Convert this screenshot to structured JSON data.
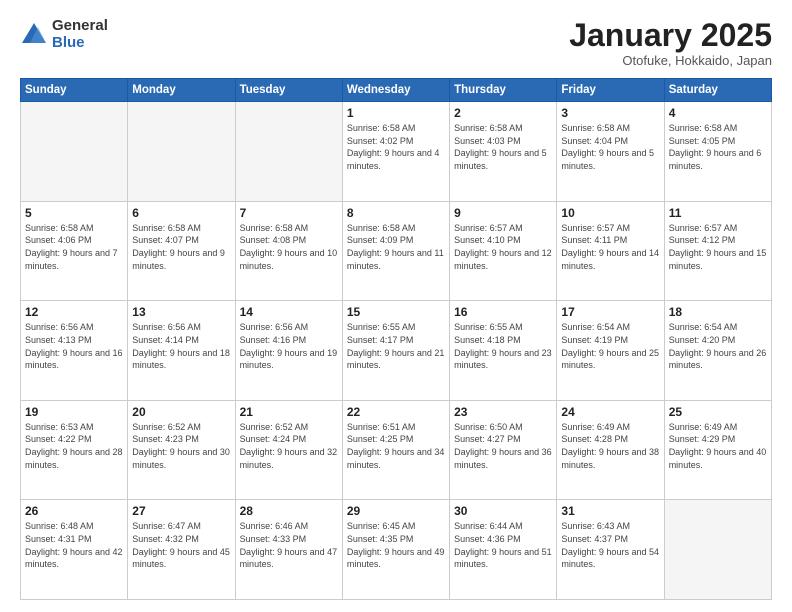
{
  "logo": {
    "general": "General",
    "blue": "Blue"
  },
  "header": {
    "month": "January 2025",
    "location": "Otofuke, Hokkaido, Japan"
  },
  "weekdays": [
    "Sunday",
    "Monday",
    "Tuesday",
    "Wednesday",
    "Thursday",
    "Friday",
    "Saturday"
  ],
  "weeks": [
    [
      {
        "day": "",
        "info": ""
      },
      {
        "day": "",
        "info": ""
      },
      {
        "day": "",
        "info": ""
      },
      {
        "day": "1",
        "info": "Sunrise: 6:58 AM\nSunset: 4:02 PM\nDaylight: 9 hours\nand 4 minutes."
      },
      {
        "day": "2",
        "info": "Sunrise: 6:58 AM\nSunset: 4:03 PM\nDaylight: 9 hours\nand 5 minutes."
      },
      {
        "day": "3",
        "info": "Sunrise: 6:58 AM\nSunset: 4:04 PM\nDaylight: 9 hours\nand 5 minutes."
      },
      {
        "day": "4",
        "info": "Sunrise: 6:58 AM\nSunset: 4:05 PM\nDaylight: 9 hours\nand 6 minutes."
      }
    ],
    [
      {
        "day": "5",
        "info": "Sunrise: 6:58 AM\nSunset: 4:06 PM\nDaylight: 9 hours\nand 7 minutes."
      },
      {
        "day": "6",
        "info": "Sunrise: 6:58 AM\nSunset: 4:07 PM\nDaylight: 9 hours\nand 9 minutes."
      },
      {
        "day": "7",
        "info": "Sunrise: 6:58 AM\nSunset: 4:08 PM\nDaylight: 9 hours\nand 10 minutes."
      },
      {
        "day": "8",
        "info": "Sunrise: 6:58 AM\nSunset: 4:09 PM\nDaylight: 9 hours\nand 11 minutes."
      },
      {
        "day": "9",
        "info": "Sunrise: 6:57 AM\nSunset: 4:10 PM\nDaylight: 9 hours\nand 12 minutes."
      },
      {
        "day": "10",
        "info": "Sunrise: 6:57 AM\nSunset: 4:11 PM\nDaylight: 9 hours\nand 14 minutes."
      },
      {
        "day": "11",
        "info": "Sunrise: 6:57 AM\nSunset: 4:12 PM\nDaylight: 9 hours\nand 15 minutes."
      }
    ],
    [
      {
        "day": "12",
        "info": "Sunrise: 6:56 AM\nSunset: 4:13 PM\nDaylight: 9 hours\nand 16 minutes."
      },
      {
        "day": "13",
        "info": "Sunrise: 6:56 AM\nSunset: 4:14 PM\nDaylight: 9 hours\nand 18 minutes."
      },
      {
        "day": "14",
        "info": "Sunrise: 6:56 AM\nSunset: 4:16 PM\nDaylight: 9 hours\nand 19 minutes."
      },
      {
        "day": "15",
        "info": "Sunrise: 6:55 AM\nSunset: 4:17 PM\nDaylight: 9 hours\nand 21 minutes."
      },
      {
        "day": "16",
        "info": "Sunrise: 6:55 AM\nSunset: 4:18 PM\nDaylight: 9 hours\nand 23 minutes."
      },
      {
        "day": "17",
        "info": "Sunrise: 6:54 AM\nSunset: 4:19 PM\nDaylight: 9 hours\nand 25 minutes."
      },
      {
        "day": "18",
        "info": "Sunrise: 6:54 AM\nSunset: 4:20 PM\nDaylight: 9 hours\nand 26 minutes."
      }
    ],
    [
      {
        "day": "19",
        "info": "Sunrise: 6:53 AM\nSunset: 4:22 PM\nDaylight: 9 hours\nand 28 minutes."
      },
      {
        "day": "20",
        "info": "Sunrise: 6:52 AM\nSunset: 4:23 PM\nDaylight: 9 hours\nand 30 minutes."
      },
      {
        "day": "21",
        "info": "Sunrise: 6:52 AM\nSunset: 4:24 PM\nDaylight: 9 hours\nand 32 minutes."
      },
      {
        "day": "22",
        "info": "Sunrise: 6:51 AM\nSunset: 4:25 PM\nDaylight: 9 hours\nand 34 minutes."
      },
      {
        "day": "23",
        "info": "Sunrise: 6:50 AM\nSunset: 4:27 PM\nDaylight: 9 hours\nand 36 minutes."
      },
      {
        "day": "24",
        "info": "Sunrise: 6:49 AM\nSunset: 4:28 PM\nDaylight: 9 hours\nand 38 minutes."
      },
      {
        "day": "25",
        "info": "Sunrise: 6:49 AM\nSunset: 4:29 PM\nDaylight: 9 hours\nand 40 minutes."
      }
    ],
    [
      {
        "day": "26",
        "info": "Sunrise: 6:48 AM\nSunset: 4:31 PM\nDaylight: 9 hours\nand 42 minutes."
      },
      {
        "day": "27",
        "info": "Sunrise: 6:47 AM\nSunset: 4:32 PM\nDaylight: 9 hours\nand 45 minutes."
      },
      {
        "day": "28",
        "info": "Sunrise: 6:46 AM\nSunset: 4:33 PM\nDaylight: 9 hours\nand 47 minutes."
      },
      {
        "day": "29",
        "info": "Sunrise: 6:45 AM\nSunset: 4:35 PM\nDaylight: 9 hours\nand 49 minutes."
      },
      {
        "day": "30",
        "info": "Sunrise: 6:44 AM\nSunset: 4:36 PM\nDaylight: 9 hours\nand 51 minutes."
      },
      {
        "day": "31",
        "info": "Sunrise: 6:43 AM\nSunset: 4:37 PM\nDaylight: 9 hours\nand 54 minutes."
      },
      {
        "day": "",
        "info": ""
      }
    ]
  ]
}
